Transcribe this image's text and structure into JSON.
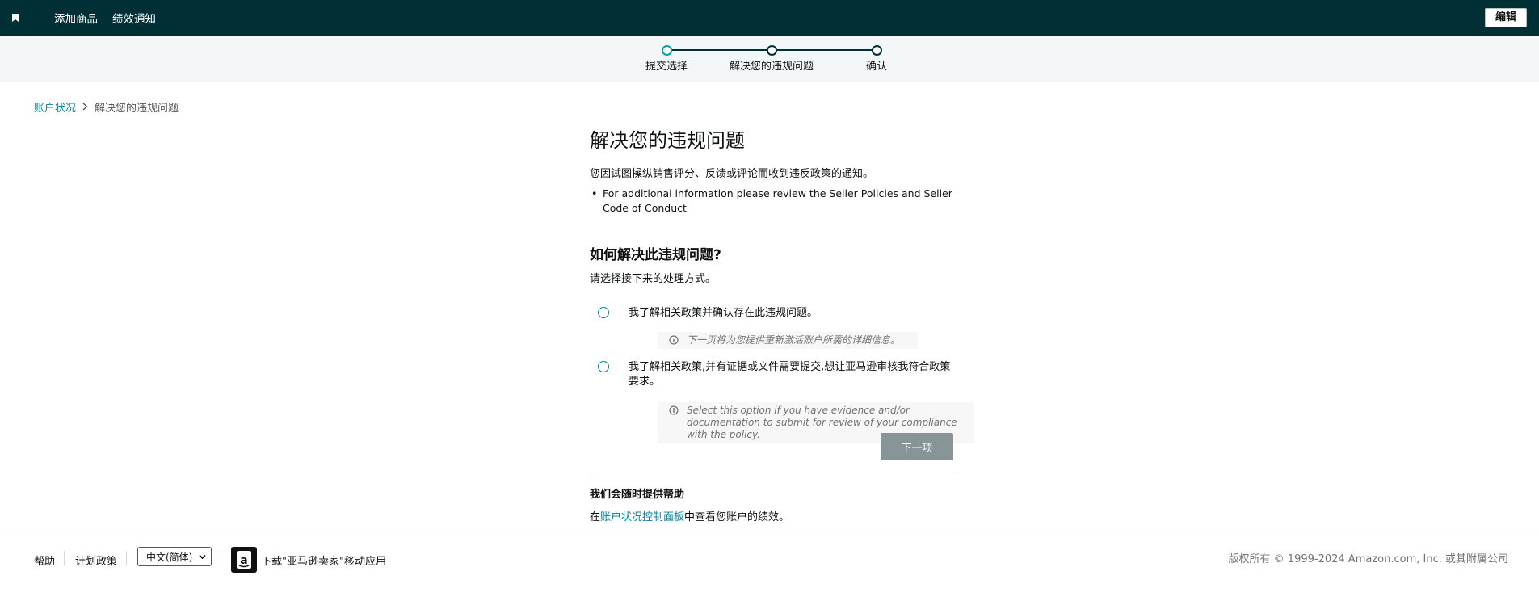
{
  "topbar": {
    "nav": [
      "添加商品",
      "绩效通知"
    ],
    "edit_label": "编辑"
  },
  "stepper": {
    "steps": [
      "提交选择",
      "解决您的违规问题",
      "确认"
    ],
    "current_index": 0
  },
  "breadcrumb": {
    "parent": "账户状况",
    "current": "解决您的违规问题"
  },
  "main": {
    "title": "解决您的违规问题",
    "intro": "您因试图操纵销售评分、反馈或评论而收到违反政策的通知。",
    "bullet": "For additional information please review the Seller Policies and Seller Code of Conduct",
    "section_title": "如何解决此违规问题?",
    "section_sub": "请选择接下来的处理方式。",
    "options": [
      {
        "label": "我了解相关政策并确认存在此违规问题。",
        "hint": "下一页将为您提供重新激活账户所需的详细信息。"
      },
      {
        "label": "我了解相关政策,并有证据或文件需要提交,想让亚马逊审核我符合政策要求。",
        "hint": "Select this option if you have evidence and/or documentation to submit for review of your compliance with the policy."
      }
    ],
    "next_label": "下一项",
    "help_title": "我们会随时提供帮助",
    "help_prefix": "在",
    "help_link": "账户状况控制面板",
    "help_suffix": "中查看您账户的绩效。"
  },
  "footer": {
    "help": "帮助",
    "policies": "计划政策",
    "language": "中文(简体)",
    "app_download": "下载\"亚马逊卖家\"移动应用",
    "copyright": "版权所有 © 1999-2024 Amazon.com, Inc. 或其附属公司"
  },
  "colors": {
    "topbar": "#002f36",
    "accent": "#008296",
    "active_step": "#00a19f",
    "button_disabled": "#879596"
  }
}
